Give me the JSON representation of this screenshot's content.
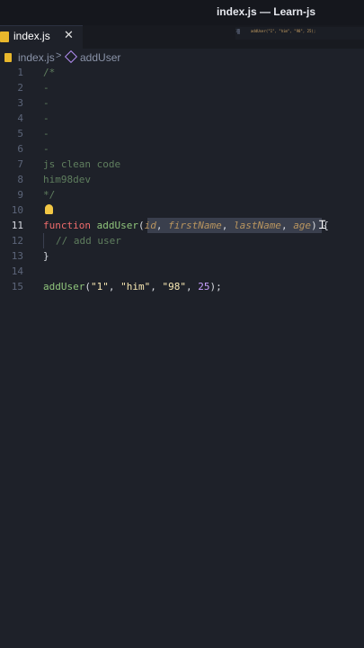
{
  "window": {
    "title": "index.js — Learn-js"
  },
  "tab": {
    "label": "index.js",
    "close_glyph": "✕",
    "icon": "js-file-icon"
  },
  "minimap": {
    "line_number": "15",
    "code": "addUser(\"1\", \"him\", \"98\", 25);"
  },
  "breadcrumb": {
    "file": "index.js",
    "separator": ">",
    "symbol": "addUser"
  },
  "colors": {
    "background": "#1e2129",
    "keyword": "#ef6c6c",
    "function": "#8fc47b",
    "string": "#f6e6b1",
    "number": "#c8a0ff",
    "comment": "#5f7e5e",
    "parameter": "#b9955f"
  },
  "editor": {
    "active_line": 11,
    "lines": [
      {
        "num": "1",
        "text": "/*"
      },
      {
        "num": "2",
        "text": "-"
      },
      {
        "num": "3",
        "text": "-"
      },
      {
        "num": "4",
        "text": "-"
      },
      {
        "num": "5",
        "text": "-"
      },
      {
        "num": "6",
        "text": "-"
      },
      {
        "num": "7",
        "text": "js clean code"
      },
      {
        "num": "8",
        "text": "him98dev"
      },
      {
        "num": "9",
        "text": "*/"
      },
      {
        "num": "10",
        "text": ""
      },
      {
        "num": "11",
        "kw": "function",
        "fn": "addUser",
        "open": "(",
        "p1": "id",
        "p2": "firstName",
        "p3": "lastName",
        "p4": "age",
        "close": ") {",
        "comma": ", "
      },
      {
        "num": "12",
        "text": "// add user"
      },
      {
        "num": "13",
        "text": "}"
      },
      {
        "num": "14",
        "text": ""
      },
      {
        "num": "15",
        "fn": "addUser",
        "open": "(",
        "s1": "\"1\"",
        "s2": "\"him\"",
        "s3": "\"98\"",
        "n1": "25",
        "close": ");",
        "comma": ", "
      }
    ]
  }
}
